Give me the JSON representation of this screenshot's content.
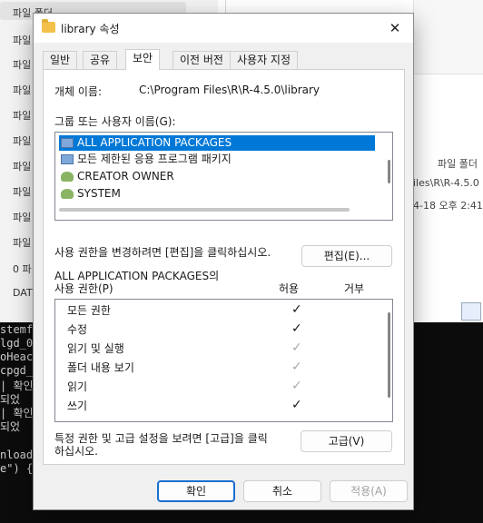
{
  "background": {
    "nav_items": [
      {
        "label": "파일 폴더"
      },
      {
        "label": "파일"
      },
      {
        "label": "파일"
      },
      {
        "label": "파일"
      },
      {
        "label": "파일"
      },
      {
        "label": "파일"
      },
      {
        "label": "파일"
      },
      {
        "label": "파일"
      },
      {
        "label": "파일"
      },
      {
        "label": "파일"
      },
      {
        "label": "0 파"
      },
      {
        "label": "DAT"
      }
    ],
    "detail_type": "파일 폴더",
    "detail_path": "iles\\R\\R-4.5.0",
    "detail_date": "4-18 오후 2:41",
    "terminal_lines": [
      "stemfc",
      "lgd_0",
      "oHeac",
      "cpgd_",
      "| 확인",
      "되었",
      "| 확인",
      "되었",
      "",
      "nload",
      "e\") {"
    ]
  },
  "dialog": {
    "title": "library 속성",
    "close_icon": "close-icon",
    "folder_icon": "folder-icon",
    "tabs": [
      {
        "label": "일반"
      },
      {
        "label": "공유"
      },
      {
        "label": "보안"
      },
      {
        "label": "이전 버전"
      },
      {
        "label": "사용자 지정"
      }
    ],
    "active_tab": "보안",
    "object_name_label": "개체 이름:",
    "object_name_value": "C:\\Program Files\\R\\R-4.5.0\\library",
    "groups_label": "그룹 또는 사용자 이름(G):",
    "groups": [
      {
        "name": "ALL APPLICATION PACKAGES",
        "icon": "package-icon",
        "selected": true
      },
      {
        "name": "모든 제한된 응용 프로그램 패키지",
        "icon": "package-icon",
        "selected": false
      },
      {
        "name": "CREATOR OWNER",
        "icon": "users-icon",
        "selected": false
      },
      {
        "name": "SYSTEM",
        "icon": "users-icon",
        "selected": false
      }
    ],
    "change_hint": "사용 권한을 변경하려면 [편집]을 클릭하십시오.",
    "edit_button": "편집(E)...",
    "permissions_for_line1": "ALL APPLICATION PACKAGES의",
    "permissions_for_line2": "사용 권한(P)",
    "allow_header": "허용",
    "deny_header": "거부",
    "permissions": [
      {
        "name": "모든 권한",
        "allow": true,
        "inherited": false
      },
      {
        "name": "수정",
        "allow": true,
        "inherited": false
      },
      {
        "name": "읽기 및 실행",
        "allow": true,
        "inherited": true
      },
      {
        "name": "폴더 내용 보기",
        "allow": true,
        "inherited": true
      },
      {
        "name": "읽기",
        "allow": true,
        "inherited": true
      },
      {
        "name": "쓰기",
        "allow": true,
        "inherited": false
      }
    ],
    "advanced_hint_line1": "특정 권한 및 고급 설정을 보려면 [고급]을 클릭",
    "advanced_hint_line2": "하십시오.",
    "advanced_button": "고급(V)",
    "ok_button": "확인",
    "cancel_button": "취소",
    "apply_button": "적용(A)",
    "check_mark": "✓",
    "close_glyph": "✕"
  }
}
